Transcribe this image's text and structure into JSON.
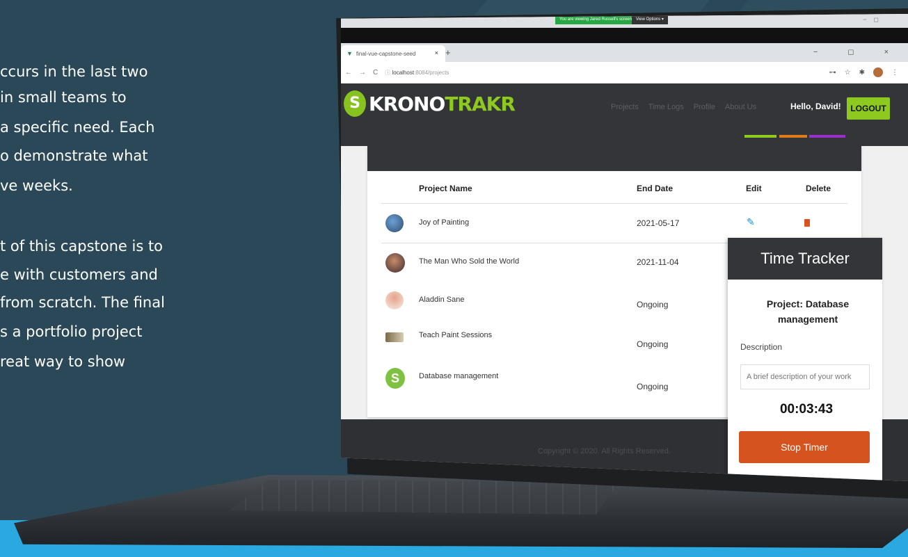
{
  "slide_text": {
    "lines": [
      "ccurs in the last two",
      "in small teams to",
      "a specific need. Each",
      "o demonstrate what",
      "ve weeks.",
      "t of this capstone is to",
      "e with customers and",
      "from scratch. The final",
      "s a portfolio project",
      "reat way to show"
    ]
  },
  "share_bar": {
    "sharing": "You are viewing Jared Russell's screen",
    "options": "View Options ▾"
  },
  "browser": {
    "tab_title": "final-vue-capstone-seed",
    "tab_close": "×",
    "new_tab": "+",
    "url_host": "localhost",
    "url_path": ":8084/projects",
    "window_controls": "− ◻ ×"
  },
  "app": {
    "logo_mark": "S",
    "logo_white": "KRONO",
    "logo_green": "TRAKR",
    "nav": [
      "Projects",
      "Time Logs",
      "Profile",
      "About Us"
    ],
    "greeting": "Hello, David!",
    "logout": "LOGOUT",
    "accent_colors": [
      "#8dc91e",
      "#e07b1a",
      "#9b2fc8"
    ]
  },
  "table": {
    "headers": {
      "name": "Project Name",
      "end": "End Date",
      "edit": "Edit",
      "delete": "Delete"
    },
    "rows": [
      {
        "name": "Joy of Painting",
        "end": "2021-05-17"
      },
      {
        "name": "The Man Who Sold the World",
        "end": "2021-11-04"
      },
      {
        "name": "Aladdin Sane",
        "end": "Ongoing"
      },
      {
        "name": "Teach Paint Sessions",
        "end": "Ongoing"
      },
      {
        "name": "Database management",
        "end": "Ongoing"
      }
    ]
  },
  "footer": {
    "copyright": "Copyright © 2020. All Rights Reserved."
  },
  "tracker": {
    "title": "Time Tracker",
    "project_line1": "Project: Database",
    "project_line2": "management",
    "description_label": "Description",
    "description_placeholder": "A brief description of your work",
    "timer": "00:03:43",
    "stop_button": "Stop Timer"
  }
}
